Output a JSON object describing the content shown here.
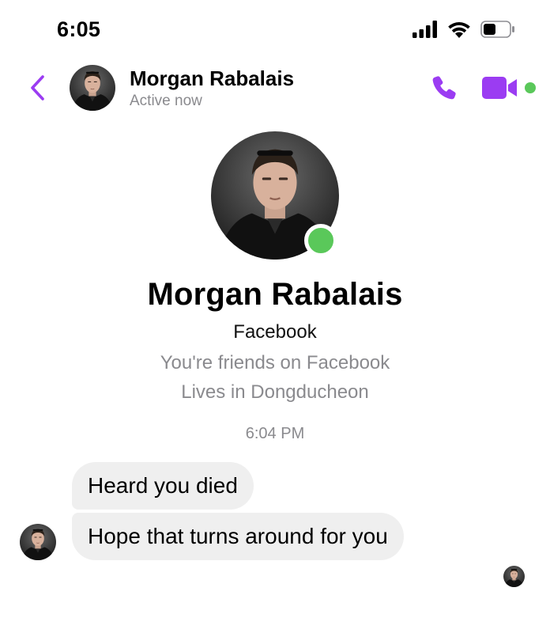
{
  "status_bar": {
    "time": "6:05",
    "icons": [
      "cellular-signal-icon",
      "wifi-icon",
      "battery-icon"
    ]
  },
  "header": {
    "back_icon": "chevron-left-icon",
    "contact_name": "Morgan Rabalais",
    "status": "Active now",
    "call_icon": "phone-icon",
    "video_icon": "video-camera-icon"
  },
  "profile": {
    "name": "Morgan Rabalais",
    "platform": "Facebook",
    "friends_text": "You're friends on Facebook",
    "location_text": "Lives in Dongducheon"
  },
  "conversation": {
    "timestamp": "6:04 PM",
    "messages": [
      {
        "sender": "Morgan Rabalais",
        "text": "Heard you died"
      },
      {
        "sender": "Morgan Rabalais",
        "text": "Hope that turns around for you"
      }
    ]
  },
  "colors": {
    "accent": "#9b3cf2",
    "online": "#5ac85a",
    "bubble": "#efefef",
    "secondary_text": "#8a8a8e"
  }
}
